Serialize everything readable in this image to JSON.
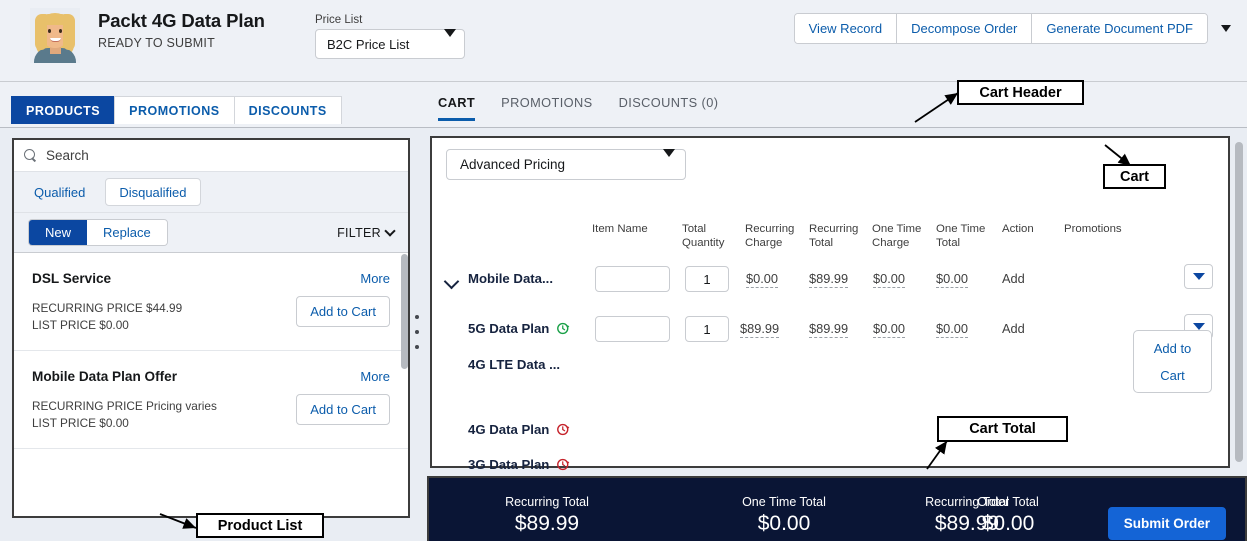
{
  "header": {
    "record_title": "Packt 4G Data Plan",
    "record_status": "READY TO SUBMIT",
    "price_list_label": "Price List",
    "price_list_value": "B2C Price List",
    "actions": [
      {
        "label": "View Record"
      },
      {
        "label": "Decompose Order"
      },
      {
        "label": "Generate Document PDF"
      }
    ],
    "more_icon": "chevron-down-icon"
  },
  "left_tabs": [
    {
      "label": "PRODUCTS",
      "active": true
    },
    {
      "label": "PROMOTIONS",
      "active": false
    },
    {
      "label": "DISCOUNTS",
      "active": false
    }
  ],
  "cart_tabs": [
    {
      "label": "CART",
      "active": true
    },
    {
      "label": "PROMOTIONS",
      "active": false
    },
    {
      "label": "DISCOUNTS (0)",
      "active": false
    }
  ],
  "product_panel": {
    "search_placeholder": "Search",
    "search_value": "",
    "search_icon": "search-icon",
    "qualified_label": "Qualified",
    "disqualified_label": "Disqualified",
    "new_label": "New",
    "replace_label": "Replace",
    "filter_label": "FILTER",
    "filter_icon": "chevron-down-icon",
    "products": [
      {
        "name": "DSL Service",
        "more_label": "More",
        "recurring_price": "RECURRING PRICE $44.99",
        "list_price": "LIST PRICE $0.00",
        "add_label": "Add to Cart"
      },
      {
        "name": "Mobile Data Plan Offer",
        "more_label": "More",
        "recurring_price": "RECURRING PRICE Pricing varies",
        "list_price": "LIST PRICE $0.00",
        "add_label": "Add to Cart"
      }
    ]
  },
  "cart": {
    "pricing_mode": "Advanced Pricing",
    "pricing_icon": "chevron-down-icon",
    "columns": [
      "Item Name",
      "Total\nQuantity",
      "Recurring\nCharge",
      "Recurring\nTotal",
      "One Time\nCharge",
      "One Time\nTotal",
      "Action",
      "Promotions"
    ],
    "rows": [
      {
        "name": "Mobile Data...",
        "expandable": true,
        "recur_icon": "",
        "item_name": "",
        "total_quantity": "1",
        "recurring_charge": "$0.00",
        "recurring_total": "$89.99",
        "one_time_charge": "$0.00",
        "one_time_total": "$0.00",
        "action": "Add",
        "promotion_dropdown": true
      },
      {
        "name": "5G Data Plan",
        "expandable": false,
        "recur_icon": "recurring-green-icon",
        "item_name": "",
        "total_quantity": "1",
        "recurring_charge": "$89.99",
        "recurring_total": "$89.99",
        "one_time_charge": "$0.00",
        "one_time_total": "$0.00",
        "action": "Add",
        "promotion_dropdown": true
      },
      {
        "name": "4G LTE Data ...",
        "expandable": false,
        "recur_icon": "",
        "item_name": "",
        "total_quantity": "",
        "recurring_charge": "",
        "recurring_total": "",
        "one_time_charge": "",
        "one_time_total": "",
        "action": "",
        "promotion_dropdown": false
      },
      {
        "name": "4G Data Plan",
        "expandable": false,
        "recur_icon": "recurring-red-icon",
        "item_name": "",
        "total_quantity": "",
        "recurring_charge": "",
        "recurring_total": "",
        "one_time_charge": "",
        "one_time_total": "",
        "action": "",
        "promotion_dropdown": false
      },
      {
        "name": "3G Data Plan",
        "expandable": false,
        "recur_icon": "recurring-red-icon",
        "item_name": "",
        "total_quantity": "",
        "recurring_charge": "",
        "recurring_total": "",
        "one_time_charge": "",
        "one_time_total": "",
        "action": "",
        "promotion_dropdown": false
      }
    ],
    "add_to_cart_line1": "Add to",
    "add_to_cart_line2": "Cart"
  },
  "totals": {
    "items": [
      {
        "label": "Recurring Total",
        "value": "$89.99"
      },
      {
        "label": "One Time Total",
        "value": "$0.00"
      },
      {
        "label": "Order Total",
        "value": "$0.00"
      }
    ],
    "submit_label": "Submit Order"
  },
  "annotations": [
    {
      "text": "Cart Header"
    },
    {
      "text": "Cart"
    },
    {
      "text": "Cart Total"
    },
    {
      "text": "Product List"
    }
  ],
  "colors": {
    "brand_blue": "#0b47a1",
    "link_blue": "#0b5cab",
    "total_bar": "#0a1535",
    "submit_blue": "#1464d6",
    "recur_green": "#19a047",
    "recur_red": "#c5222a"
  }
}
